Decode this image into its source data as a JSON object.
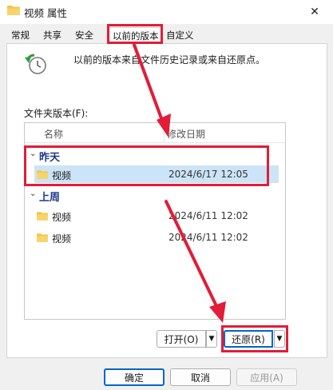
{
  "window": {
    "title": "视频 属性",
    "close_glyph": "✕"
  },
  "tabs": [
    {
      "label": "常规"
    },
    {
      "label": "共享"
    },
    {
      "label": "安全"
    },
    {
      "label": "以前的版本",
      "active": true
    },
    {
      "label": "自定义"
    }
  ],
  "description": "以前的版本来自文件历史记录或来自还原点。",
  "list": {
    "label": "文件夹版本(F):",
    "columns": {
      "name": "名称",
      "date": "修改日期"
    },
    "groups": [
      {
        "title": "昨天",
        "rows": [
          {
            "name": "视频",
            "date": "2024/6/17 12:05",
            "selected": true
          }
        ]
      },
      {
        "title": "上周",
        "rows": [
          {
            "name": "视频",
            "date": "2024/6/11 12:02"
          },
          {
            "name": "视频",
            "date": "2024/6/11 12:02"
          }
        ]
      }
    ]
  },
  "buttons": {
    "open": "打开(O)",
    "restore": "还原(R)",
    "ok": "确定",
    "cancel": "取消",
    "apply": "应用(A)"
  },
  "colors": {
    "accent": "#0067c0",
    "highlight": "#e11d38",
    "selected_row": "#cce4f7",
    "folder": "#f3c54a"
  },
  "icons": [
    "folder-icon",
    "close-icon",
    "restore-clock-icon",
    "chevron-down-icon",
    "dropdown-arrow-icon"
  ]
}
